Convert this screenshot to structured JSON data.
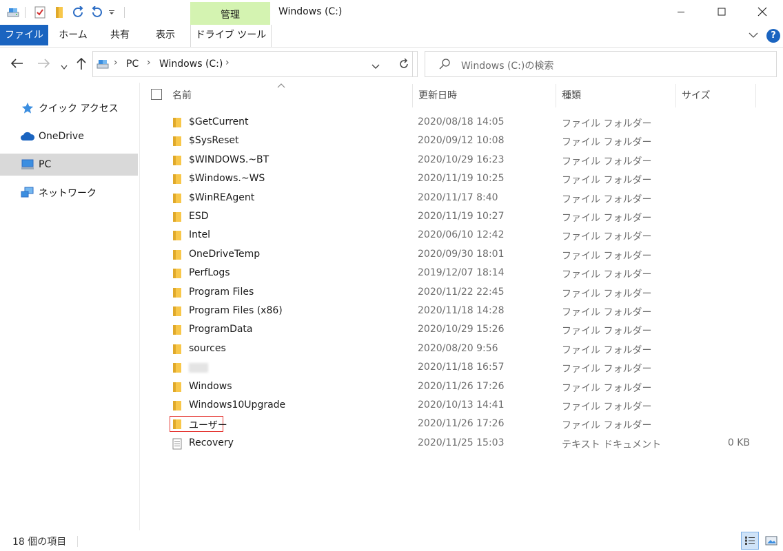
{
  "window": {
    "title": "Windows (C:)",
    "context_tab": "管理",
    "controls": [
      "minimize",
      "maximize",
      "close"
    ]
  },
  "ribbon": {
    "tabs": [
      "ファイル",
      "ホーム",
      "共有",
      "表示",
      "ドライブ ツール"
    ]
  },
  "address": {
    "breadcrumb": [
      "PC",
      "Windows (C:)"
    ]
  },
  "search": {
    "placeholder": "Windows (C:)の検索"
  },
  "sidebar": {
    "items": [
      {
        "label": "クイック アクセス",
        "icon": "star-icon"
      },
      {
        "label": "OneDrive",
        "icon": "cloud-icon"
      },
      {
        "label": "PC",
        "icon": "computer-icon",
        "selected": true
      },
      {
        "label": "ネットワーク",
        "icon": "network-icon"
      }
    ]
  },
  "columns": [
    "名前",
    "更新日時",
    "種類",
    "サイズ"
  ],
  "files": [
    {
      "name": "$GetCurrent",
      "date": "2020/08/18 14:05",
      "type": "ファイル フォルダー",
      "size": "",
      "icon": "folder-icon"
    },
    {
      "name": "$SysReset",
      "date": "2020/09/12 10:08",
      "type": "ファイル フォルダー",
      "size": "",
      "icon": "folder-icon"
    },
    {
      "name": "$WINDOWS.~BT",
      "date": "2020/10/29 16:23",
      "type": "ファイル フォルダー",
      "size": "",
      "icon": "folder-icon"
    },
    {
      "name": "$Windows.~WS",
      "date": "2020/11/19 10:25",
      "type": "ファイル フォルダー",
      "size": "",
      "icon": "folder-icon"
    },
    {
      "name": "$WinREAgent",
      "date": "2020/11/17 8:40",
      "type": "ファイル フォルダー",
      "size": "",
      "icon": "folder-icon"
    },
    {
      "name": "ESD",
      "date": "2020/11/19 10:27",
      "type": "ファイル フォルダー",
      "size": "",
      "icon": "folder-icon"
    },
    {
      "name": "Intel",
      "date": "2020/06/10 12:42",
      "type": "ファイル フォルダー",
      "size": "",
      "icon": "folder-icon"
    },
    {
      "name": "OneDriveTemp",
      "date": "2020/09/30 18:01",
      "type": "ファイル フォルダー",
      "size": "",
      "icon": "folder-icon"
    },
    {
      "name": "PerfLogs",
      "date": "2019/12/07 18:14",
      "type": "ファイル フォルダー",
      "size": "",
      "icon": "folder-icon"
    },
    {
      "name": "Program Files",
      "date": "2020/11/22 22:45",
      "type": "ファイル フォルダー",
      "size": "",
      "icon": "folder-icon"
    },
    {
      "name": "Program Files (x86)",
      "date": "2020/11/18 14:28",
      "type": "ファイル フォルダー",
      "size": "",
      "icon": "folder-icon"
    },
    {
      "name": "ProgramData",
      "date": "2020/10/29 15:26",
      "type": "ファイル フォルダー",
      "size": "",
      "icon": "folder-icon"
    },
    {
      "name": "sources",
      "date": "2020/08/20 9:56",
      "type": "ファイル フォルダー",
      "size": "",
      "icon": "folder-icon"
    },
    {
      "name": "",
      "date": "2020/11/18 16:57",
      "type": "ファイル フォルダー",
      "size": "",
      "icon": "folder-icon",
      "blurred": true
    },
    {
      "name": "Windows",
      "date": "2020/11/26 17:26",
      "type": "ファイル フォルダー",
      "size": "",
      "icon": "folder-icon"
    },
    {
      "name": "Windows10Upgrade",
      "date": "2020/10/13 14:41",
      "type": "ファイル フォルダー",
      "size": "",
      "icon": "folder-icon"
    },
    {
      "name": "ユーザー",
      "date": "2020/11/26 17:26",
      "type": "ファイル フォルダー",
      "size": "",
      "icon": "folder-icon",
      "highlighted": true
    },
    {
      "name": "Recovery",
      "date": "2020/11/25 15:03",
      "type": "テキスト ドキュメント",
      "size": "0 KB",
      "icon": "text-document-icon"
    }
  ],
  "status": {
    "item_count": "18 個の項目"
  },
  "colors": {
    "file_tab": "#1a64c0",
    "manage_tab": "#d4f3b1",
    "folder": "#f8c74a",
    "highlight_box": "#e53935",
    "selected_nav": "#d9d9d9"
  }
}
